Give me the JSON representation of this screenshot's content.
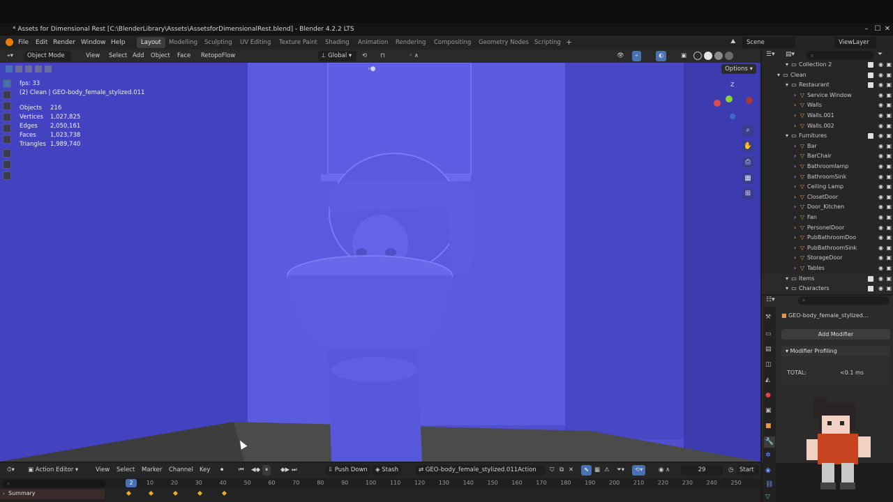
{
  "window": {
    "title": "* Assets for Dimensional Rest [C:\\BlenderLibrary\\Assets\\AssetsforDimensionalRest.blend] - Blender 4.2.2 LTS",
    "controls": [
      "–",
      "☐",
      "✕"
    ]
  },
  "menu": {
    "items": [
      "File",
      "Edit",
      "Render",
      "Window",
      "Help"
    ],
    "workspaces": [
      "Layout",
      "Modelling",
      "Sculpting",
      "UV Editing",
      "Texture Paint",
      "Shading",
      "Animation",
      "Rendering",
      "Compositing",
      "Geometry Nodes",
      "Scripting"
    ],
    "active_workspace": "Layout",
    "scene": "Scene",
    "view_layer": "ViewLayer"
  },
  "viewport_header": {
    "mode": "Object Mode",
    "menus": [
      "View",
      "Select",
      "Add",
      "Object",
      "Face",
      "RetopoFlow"
    ],
    "orientation": "Global",
    "options": "Options"
  },
  "overlay": {
    "fps": "fps: 33",
    "object_line": "(2) Clean | GEO-body_female_stylized.011",
    "stats": [
      {
        "label": "Objects",
        "value": "216"
      },
      {
        "label": "Vertices",
        "value": "1,027,825"
      },
      {
        "label": "Edges",
        "value": "2,050,161"
      },
      {
        "label": "Faces",
        "value": "1,023,738"
      },
      {
        "label": "Triangles",
        "value": "1,989,740"
      }
    ],
    "gizmo": {
      "x": "X",
      "y": "Y",
      "z": "Z"
    }
  },
  "outliner": {
    "search_placeholder": "",
    "rows": [
      {
        "label": "Collection 2",
        "indent": 2,
        "type": "collection"
      },
      {
        "label": "Clean",
        "indent": 1,
        "type": "collection"
      },
      {
        "label": "Restaurant",
        "indent": 2,
        "type": "collection"
      },
      {
        "label": "Service Window",
        "indent": 3,
        "type": "object"
      },
      {
        "label": "Walls",
        "indent": 3,
        "type": "object"
      },
      {
        "label": "Walls.001",
        "indent": 3,
        "type": "object"
      },
      {
        "label": "Walls.002",
        "indent": 3,
        "type": "object"
      },
      {
        "label": "Furnitures",
        "indent": 2,
        "type": "collection"
      },
      {
        "label": "Bar",
        "indent": 3,
        "type": "object"
      },
      {
        "label": "BarChair",
        "indent": 3,
        "type": "object"
      },
      {
        "label": "Bathroomlamp",
        "indent": 3,
        "type": "object"
      },
      {
        "label": "BathroomSink",
        "indent": 3,
        "type": "object"
      },
      {
        "label": "Ceiling Lamp",
        "indent": 3,
        "type": "object"
      },
      {
        "label": "ClosetDoor",
        "indent": 3,
        "type": "object"
      },
      {
        "label": "Door_Kitchen",
        "indent": 3,
        "type": "object"
      },
      {
        "label": "Fan",
        "indent": 3,
        "type": "object"
      },
      {
        "label": "PersonelDoor",
        "indent": 3,
        "type": "object"
      },
      {
        "label": "PubBathroomDoo",
        "indent": 3,
        "type": "object"
      },
      {
        "label": "PubBathroomSink",
        "indent": 3,
        "type": "object"
      },
      {
        "label": "StorageDoor",
        "indent": 3,
        "type": "object"
      },
      {
        "label": "Tables",
        "indent": 3,
        "type": "object"
      },
      {
        "label": "Items",
        "indent": 2,
        "type": "collection"
      },
      {
        "label": "Characters",
        "indent": 2,
        "type": "collection"
      }
    ]
  },
  "properties": {
    "object_name": "GEO-body_female_stylized...",
    "add_modifier": "Add Modifier",
    "panel_title": "Modifier Profiling",
    "total_label": "TOTAL:",
    "total_value": "<0.1 ms"
  },
  "timeline": {
    "editor": "Action Editor",
    "menus": [
      "View",
      "Select",
      "Marker",
      "Channel",
      "Key"
    ],
    "push_down": "Push Down",
    "stash": "Stash",
    "action": "GEO-body_female_stylized.011Action",
    "frame": "29",
    "start_label": "Start",
    "current_frame": "2",
    "ticks": [
      "10",
      "20",
      "30",
      "40",
      "50",
      "60",
      "70",
      "80",
      "90",
      "100",
      "110",
      "120",
      "130",
      "140",
      "150",
      "160",
      "170",
      "180",
      "190",
      "200",
      "210",
      "220",
      "230",
      "240",
      "250"
    ],
    "summary": "Summary",
    "keyframes": [
      1,
      10,
      20,
      30,
      40
    ]
  },
  "colors": {
    "viewport": "#4f4fcf",
    "accent": "#4772b3",
    "keyframe": "#e8b02a"
  }
}
